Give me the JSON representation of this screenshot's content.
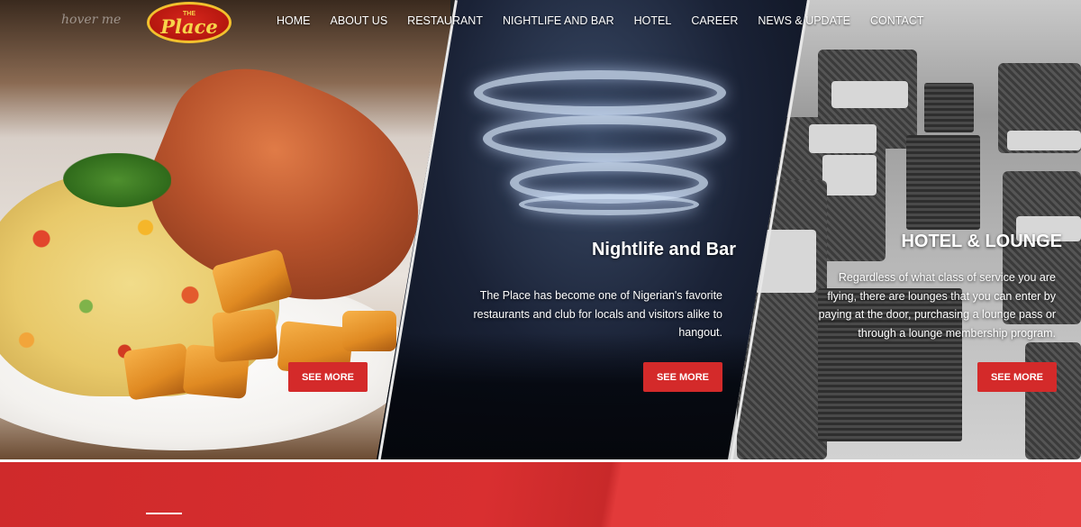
{
  "brand": {
    "logo_top": "THE",
    "logo_main": "Place",
    "hover_text": "hover me"
  },
  "nav": {
    "items": [
      {
        "label": "HOME"
      },
      {
        "label": "ABOUT US"
      },
      {
        "label": "RESTAURANT"
      },
      {
        "label": "NIGHTLIFE AND BAR"
      },
      {
        "label": "HOTEL"
      },
      {
        "label": "CAREER"
      },
      {
        "label": "NEWS & UPDATE"
      },
      {
        "label": "CONTACT"
      }
    ]
  },
  "panels": {
    "restaurant": {
      "button_label": "SEE MORE"
    },
    "nightlife": {
      "title": "Nightlife and Bar",
      "text_lines": [
        "The Place has become one of Nigerian's favorite",
        "restaurants and club for locals and visitors alike to",
        "hangout."
      ],
      "button_label": "SEE MORE"
    },
    "hotel": {
      "title": "HOTEL & LOUNGE",
      "text_lines": [
        "Regardless of what class of service you are",
        "flying, there are lounges that you can enter by",
        "paying at the door, purchasing a lounge pass or",
        "through a lounge membership program."
      ],
      "button_label": "SEE MORE"
    }
  },
  "colors": {
    "accent_red": "#d42a2a",
    "logo_gold": "#f2c12e"
  }
}
